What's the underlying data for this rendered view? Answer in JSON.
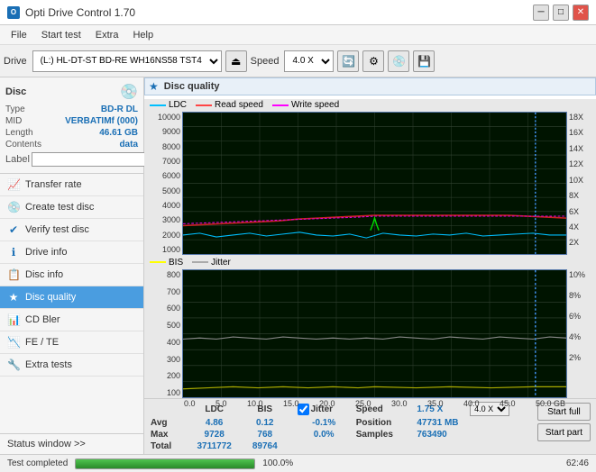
{
  "titleBar": {
    "title": "Opti Drive Control 1.70",
    "minBtn": "─",
    "maxBtn": "□",
    "closeBtn": "✕"
  },
  "menu": {
    "items": [
      "File",
      "Start test",
      "Extra",
      "Help"
    ]
  },
  "toolbar": {
    "driveLabel": "Drive",
    "driveValue": "(L:)  HL-DT-ST BD-RE  WH16NS58 TST4",
    "speedLabel": "Speed",
    "speedValue": "4.0 X"
  },
  "sidebar": {
    "discSection": {
      "title": "Disc",
      "typeLabel": "Type",
      "typeValue": "BD-R DL",
      "midLabel": "MID",
      "midValue": "VERBATIMf (000)",
      "lengthLabel": "Length",
      "lengthValue": "46.61 GB",
      "contentsLabel": "Contents",
      "contentsValue": "data",
      "labelLabel": "Label"
    },
    "navItems": [
      {
        "id": "transfer-rate",
        "label": "Transfer rate",
        "icon": "📈"
      },
      {
        "id": "create-test-disc",
        "label": "Create test disc",
        "icon": "💿"
      },
      {
        "id": "verify-test-disc",
        "label": "Verify test disc",
        "icon": "✔"
      },
      {
        "id": "drive-info",
        "label": "Drive info",
        "icon": "ℹ"
      },
      {
        "id": "disc-info",
        "label": "Disc info",
        "icon": "📋"
      },
      {
        "id": "disc-quality",
        "label": "Disc quality",
        "icon": "★",
        "active": true
      },
      {
        "id": "cd-bler",
        "label": "CD Bler",
        "icon": "📊"
      },
      {
        "id": "fe-te",
        "label": "FE / TE",
        "icon": "📉"
      },
      {
        "id": "extra-tests",
        "label": "Extra tests",
        "icon": "🔧"
      }
    ],
    "statusWindow": "Status window >>"
  },
  "discQuality": {
    "title": "Disc quality",
    "legendUpper": [
      {
        "label": "LDC",
        "color": "#00bfff"
      },
      {
        "label": "Read speed",
        "color": "#ff4444"
      },
      {
        "label": "Write speed",
        "color": "#ff00ff"
      }
    ],
    "legendLower": [
      {
        "label": "BIS",
        "color": "#ffff00"
      },
      {
        "label": "Jitter",
        "color": "#aaaaaa"
      }
    ],
    "upperYMax": "10000",
    "upperYMin": "1000",
    "lowerYMax": "800",
    "lowerYMin": "100",
    "xMax": "50.0 GB",
    "rightAxisUpper": [
      "18X",
      "16X",
      "14X",
      "12X",
      "10X",
      "8X",
      "6X",
      "4X",
      "2X"
    ],
    "rightAxisLower": [
      "10%",
      "8%",
      "6%",
      "4%",
      "2%"
    ],
    "stats": {
      "headers": [
        "LDC",
        "BIS",
        "",
        "Jitter",
        "Speed",
        "1.75 X",
        "",
        "4.0 X"
      ],
      "avgLabel": "Avg",
      "avgLDC": "4.86",
      "avgBIS": "0.12",
      "avgJitter": "-0.1%",
      "maxLabel": "Max",
      "maxLDC": "9728",
      "maxBIS": "768",
      "maxJitter": "0.0%",
      "positionLabel": "Position",
      "positionValue": "47731 MB",
      "totalLabel": "Total",
      "totalLDC": "3711772",
      "totalBIS": "89764",
      "samplesLabel": "Samples",
      "samplesValue": "763490",
      "jitterChecked": true,
      "startFullBtn": "Start full",
      "startPartBtn": "Start part"
    }
  },
  "statusBar": {
    "text": "Test completed",
    "progress": 100,
    "time": "62:46"
  }
}
